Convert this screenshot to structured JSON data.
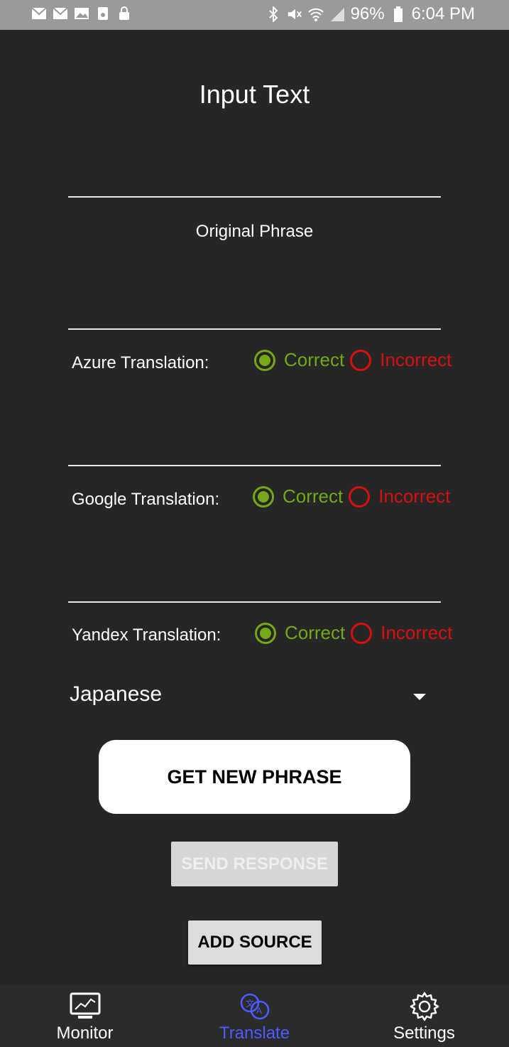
{
  "status_bar": {
    "battery": "96%",
    "time": "6:04 PM",
    "left_icons": [
      "mail-icon",
      "mail-icon",
      "image-icon",
      "storage-icon",
      "lock-icon"
    ],
    "right_icons": [
      "bluetooth-icon",
      "mute-icon",
      "wifi-icon",
      "signal-icon",
      "battery-icon"
    ]
  },
  "screen": {
    "title": "Input Text",
    "original_phrase_label": "Original Phrase"
  },
  "translations": [
    {
      "label": "Azure Translation:",
      "correct": "Correct",
      "incorrect": "Incorrect",
      "selected": "correct"
    },
    {
      "label": "Google Translation:",
      "correct": "Correct",
      "incorrect": "Incorrect",
      "selected": "correct"
    },
    {
      "label": "Yandex Translation:",
      "correct": "Correct",
      "incorrect": "Incorrect",
      "selected": "correct"
    }
  ],
  "language_select": {
    "value": "Japanese"
  },
  "buttons": {
    "get_new_phrase": "GET NEW PHRASE",
    "send_response": "SEND RESPONSE",
    "add_source": "ADD SOURCE"
  },
  "bottom_nav": [
    {
      "label": "Monitor",
      "icon": "monitor-icon",
      "active": false
    },
    {
      "label": "Translate",
      "icon": "translate-icon",
      "active": true
    },
    {
      "label": "Settings",
      "icon": "gear-icon",
      "active": false
    }
  ],
  "colors": {
    "background": "#262626",
    "correct": "#76a717",
    "incorrect": "#d90f0f",
    "active_nav": "#4a5cff"
  }
}
